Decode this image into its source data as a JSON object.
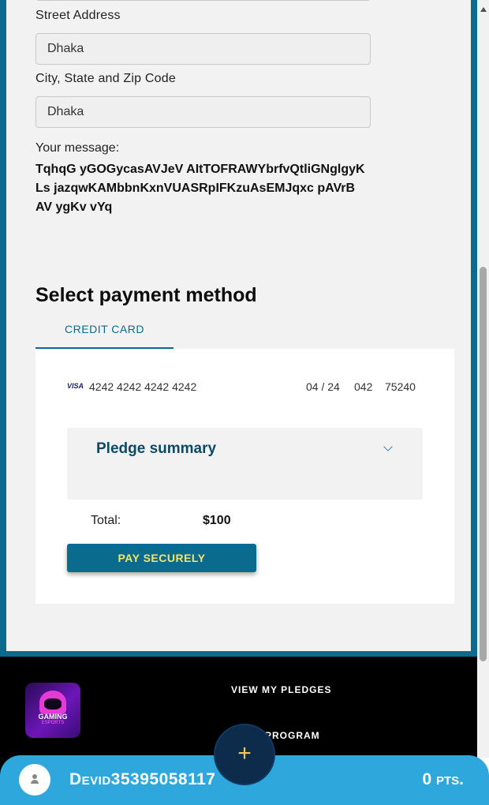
{
  "form": {
    "street_label": "Street Address",
    "street_value": "Dhaka",
    "city_label": "City, State and Zip Code",
    "city_value": "Dhaka",
    "message_label": "Your message:",
    "message_text": "TqhqG yGOGycasAVJeV AItTOFRAWYbrfvQtliGNglgyKLs jazqwKAMbbnKxnVUASRpIFKzuAsEMJqxc pAVrB AV ygKv vYq"
  },
  "payment": {
    "heading": "Select payment method",
    "tab_label": "CREDIT CARD",
    "card": {
      "brand": "VISA",
      "number": "4242 4242 4242 4242",
      "expiry": "04 / 24",
      "cvc": "042",
      "zip": "75240"
    },
    "summary_title": "Pledge summary",
    "total_label": "Total:",
    "total_value": "$100",
    "pay_button": "PAY SECURELY"
  },
  "footer": {
    "logo_text": "GAMING",
    "logo_subtext": "ESPORTS",
    "links": [
      "VIEW MY PLEDGES",
      "PROGRAM"
    ]
  },
  "fab": {
    "icon": "plus-icon",
    "symbol": "+"
  },
  "user_bar": {
    "username": "Devid35395058117",
    "points": "0 pts."
  },
  "colors": {
    "brand_blue": "#0a6b8f",
    "user_bar_blue": "#2ea8dc",
    "button_text_yellow": "#f5e36a"
  }
}
